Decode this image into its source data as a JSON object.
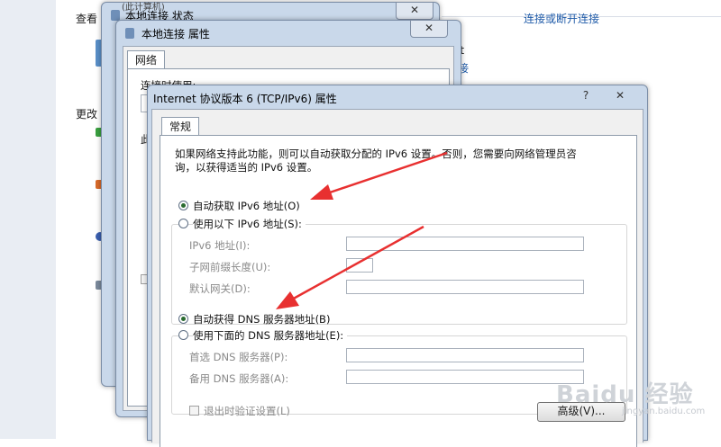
{
  "background": {
    "view_label": "查看",
    "change_label": "更改",
    "connect_link": "连接或断开连接",
    "partial_text_1": "et",
    "partial_link_2": "接",
    "top_partial": "(此计算机)"
  },
  "status_window": {
    "title": "本地连接 状态",
    "close": "✕"
  },
  "props_window": {
    "title": "本地连接 属性",
    "close": "✕",
    "tab": "网络",
    "connect_using": "连接时使用:",
    "partial_char": "此"
  },
  "ipv6_dialog": {
    "title": "Internet 协议版本 6 (TCP/IPv6) 属性",
    "help": "?",
    "close": "✕",
    "tab": "常规",
    "description_line1": "如果网络支持此功能，则可以自动获取分配的 IPv6 设置。否则，您需要向网络管理员咨",
    "description_line2": "询，以获得适当的 IPv6 设置。",
    "auto_ip_label": "自动获取 IPv6 地址(O)",
    "manual_ip_label": "使用以下 IPv6 地址(S):",
    "ipv6_address_label": "IPv6 地址(I):",
    "prefix_label": "子网前缀长度(U):",
    "gateway_label": "默认网关(D):",
    "auto_dns_label": "自动获得 DNS 服务器地址(B)",
    "manual_dns_label": "使用下面的 DNS 服务器地址(E):",
    "preferred_dns_label": "首选 DNS 服务器(P):",
    "alternate_dns_label": "备用 DNS 服务器(A):",
    "validate_label": "退出时验证设置(L)",
    "advanced_button": "高级(V)...",
    "ipv6_address_value": "",
    "prefix_value": "",
    "gateway_value": "",
    "preferred_dns_value": "",
    "alternate_dns_value": ""
  },
  "watermark": {
    "text": "Baidu 经验",
    "sub": "jingyan.baidu.com"
  },
  "colors": {
    "arrow": "#e83030",
    "link": "#1e5aa8",
    "window_frame": "#c9d8ea"
  }
}
